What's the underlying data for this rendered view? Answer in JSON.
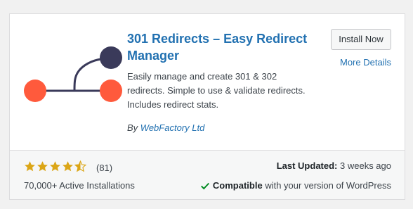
{
  "plugin": {
    "title": "301 Redirects – Easy Redirect Manager",
    "description": "Easily manage and create 301 & 302 redirects. Simple to use & validate redirects. Includes redirect stats.",
    "author_prefix": "By",
    "author": "WebFactory Ltd",
    "icon": "redirect-logo-icon"
  },
  "actions": {
    "install_label": "Install Now",
    "more_details_label": "More Details"
  },
  "meta": {
    "rating_stars": 4.5,
    "rating_count": "(81)",
    "active_installs": "70,000+ Active Installations",
    "last_updated_label": "Last Updated:",
    "last_updated_value": "3 weeks ago",
    "compatible_label": "Compatible",
    "compatible_text": "with your version of WordPress"
  },
  "colors": {
    "link": "#2271b1",
    "star": "#dba617",
    "check": "#008a20",
    "logo_dark": "#3a3a5a",
    "logo_orange": "#ff5a3c"
  }
}
